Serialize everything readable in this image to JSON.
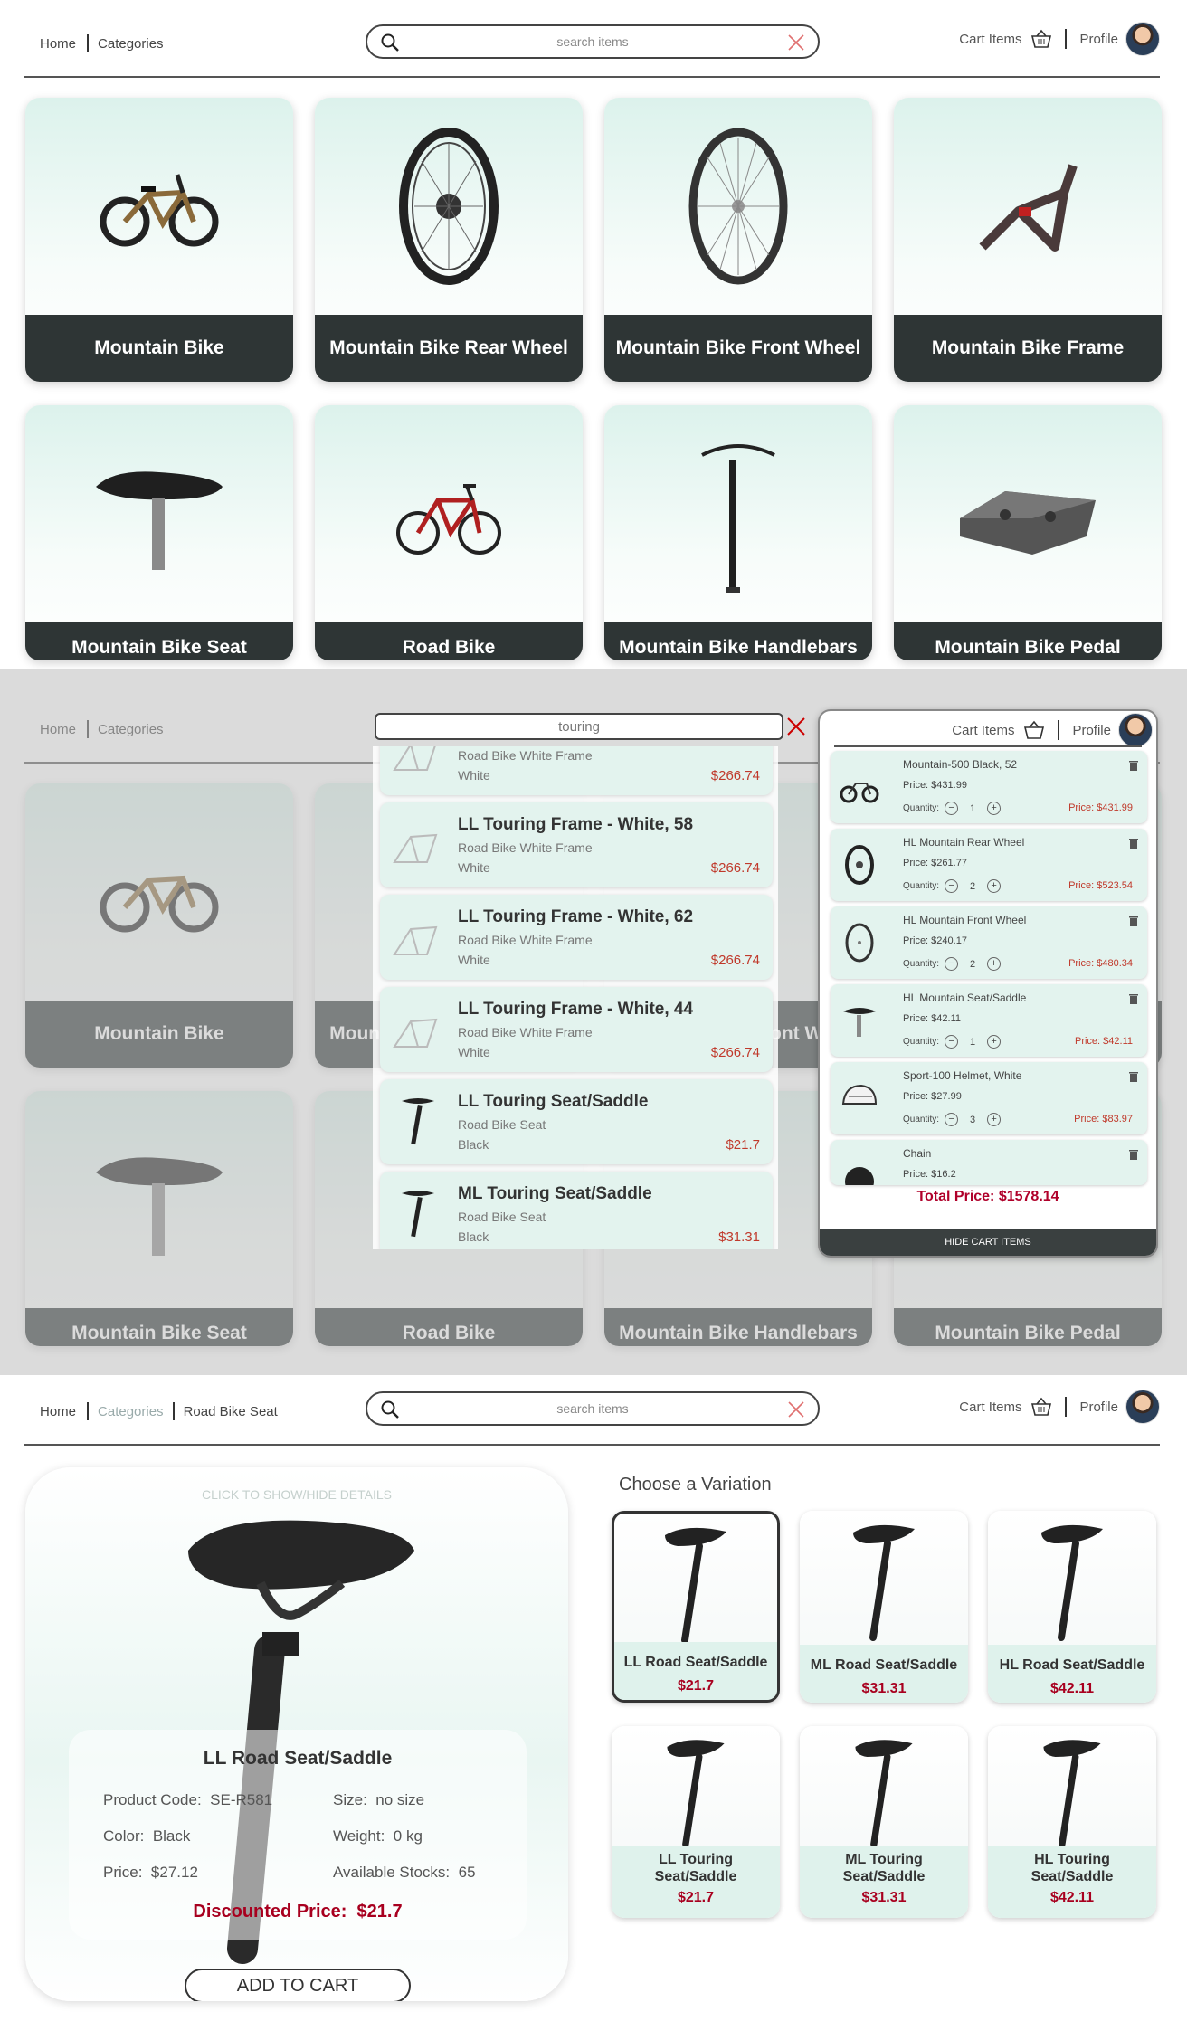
{
  "nav": {
    "home": "Home",
    "categories": "Categories",
    "search_placeholder": "search items",
    "cart_items": "Cart Items",
    "profile": "Profile"
  },
  "categories": [
    {
      "label": "Mountain Bike"
    },
    {
      "label": "Mountain Bike Rear Wheel"
    },
    {
      "label": "Mountain Bike Front Wheel"
    },
    {
      "label": "Mountain Bike Frame"
    },
    {
      "label": "Mountain Bike Seat"
    },
    {
      "label": "Road Bike"
    },
    {
      "label": "Mountain Bike Handlebars"
    },
    {
      "label": "Mountain Bike Pedal"
    }
  ],
  "search_dropdown": {
    "query": "touring",
    "results": [
      {
        "name": "",
        "subcategory": "Road Bike White Frame",
        "color": "White",
        "price": "$266.74"
      },
      {
        "name": "LL Touring Frame - White, 58",
        "subcategory": "Road Bike White Frame",
        "color": "White",
        "price": "$266.74"
      },
      {
        "name": "LL Touring Frame - White, 62",
        "subcategory": "Road Bike White Frame",
        "color": "White",
        "price": "$266.74"
      },
      {
        "name": "LL Touring Frame - White, 44",
        "subcategory": "Road Bike White Frame",
        "color": "White",
        "price": "$266.74"
      },
      {
        "name": "LL Touring Seat/Saddle",
        "subcategory": "Road Bike Seat",
        "color": "Black",
        "price": "$21.7"
      },
      {
        "name": "ML Touring Seat/Saddle",
        "subcategory": "Road Bike Seat",
        "color": "Black",
        "price": "$31.31"
      }
    ]
  },
  "cart": {
    "quantity_label": "Quantity:",
    "items": [
      {
        "name": "Mountain-500 Black, 52",
        "price": "Price:  $431.99",
        "qty": "1",
        "total": "Price:  $431.99"
      },
      {
        "name": "HL Mountain Rear Wheel",
        "price": "Price:  $261.77",
        "qty": "2",
        "total": "Price:  $523.54"
      },
      {
        "name": "HL Mountain Front Wheel",
        "price": "Price:  $240.17",
        "qty": "2",
        "total": "Price:  $480.34"
      },
      {
        "name": "HL Mountain Seat/Saddle",
        "price": "Price:  $42.11",
        "qty": "1",
        "total": "Price:  $42.11"
      },
      {
        "name": "Sport-100 Helmet, White",
        "price": "Price:  $27.99",
        "qty": "3",
        "total": "Price:  $83.97"
      },
      {
        "name": "Chain",
        "price": "Price:  $16.2",
        "qty": "",
        "total": ""
      }
    ],
    "total": "Total Price:  $1578.14",
    "hide_label": "HIDE CART ITEMS"
  },
  "product_page": {
    "breadcrumb_current": "Road Bike Seat",
    "hint": "CLICK TO SHOW/HIDE DETAILS",
    "title": "LL Road Seat/Saddle",
    "code_label": "Product Code:",
    "code": "SE-R581",
    "size_label": "Size:",
    "size": "no size",
    "color_label": "Color:",
    "color": "Black",
    "weight_label": "Weight:",
    "weight": "0 kg",
    "price_label": "Price:",
    "price": "$27.12",
    "stock_label": "Available Stocks:",
    "stock": "65",
    "discount_label": "Discounted Price:",
    "discount": "$21.7",
    "add_to_cart": "ADD TO CART",
    "variation_heading": "Choose a Variation",
    "variations": [
      {
        "name": "LL Road Seat/Saddle",
        "price": "$21.7"
      },
      {
        "name": "ML Road Seat/Saddle",
        "price": "$31.31"
      },
      {
        "name": "HL Road Seat/Saddle",
        "price": "$42.11"
      },
      {
        "name": "LL Touring Seat/Saddle",
        "price": "$21.7"
      },
      {
        "name": "ML Touring Seat/Saddle",
        "price": "$31.31"
      },
      {
        "name": "HL Touring Seat/Saddle",
        "price": "$42.11"
      }
    ]
  },
  "colors": {
    "accent_dark": "#2e3535",
    "mint": "#dcf2ec",
    "price_red": "#a8001f"
  }
}
